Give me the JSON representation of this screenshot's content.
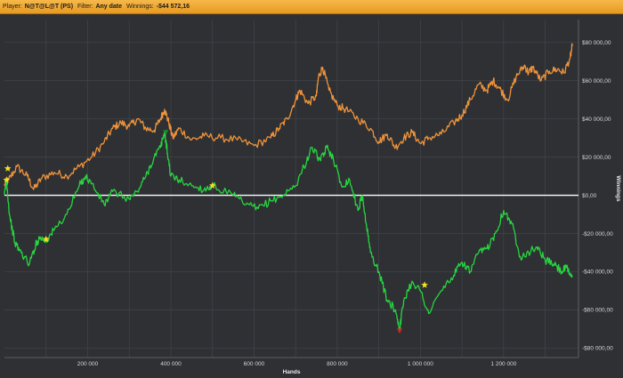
{
  "header": {
    "player_label": "Player:",
    "player_value": "N@T@L@T (PS)",
    "filter_label": "Filter:",
    "filter_value": "Any date",
    "winnings_label": "Winnings:",
    "winnings_value": "-$44 572,16"
  },
  "colors": {
    "background": "#2e3034",
    "grid": "#3f4247",
    "orange_series": "#f0933a",
    "green_series": "#27d63f",
    "zero_line": "#ffffff",
    "star": "#f5e020",
    "red_marker": "#e02020",
    "green_marker": "#1b8a2a"
  },
  "chart_data": {
    "type": "line",
    "title": "",
    "xlabel": "Hands",
    "ylabel": "Winnings",
    "xlim": [
      0,
      1380000
    ],
    "ylim": [
      -85000,
      92000
    ],
    "x_ticks": [
      200000,
      400000,
      600000,
      800000,
      1000000,
      1200000
    ],
    "x_tick_labels": [
      "200 000",
      "400 000",
      "600 000",
      "800 000",
      "1 000 000",
      "1 200 000"
    ],
    "y_ticks": [
      80000,
      60000,
      40000,
      20000,
      0,
      -20000,
      -40000,
      -60000,
      -80000
    ],
    "y_tick_labels": [
      "$80 000,00",
      "$60 000,00",
      "$40 000,00",
      "$20 000,00",
      "$0,00",
      "-$20 000,00",
      "-$40 000,00",
      "-$60 000,00",
      "-$80 000,00"
    ],
    "grid": true,
    "legend": "none",
    "series": [
      {
        "color": "orange",
        "x": [
          0,
          10000,
          30000,
          55000,
          70000,
          90000,
          120000,
          150000,
          180000,
          210000,
          240000,
          260000,
          280000,
          300000,
          320000,
          340000,
          360000,
          375000,
          385000,
          395000,
          405000,
          420000,
          450000,
          480000,
          520000,
          560000,
          600000,
          640000,
          660000,
          680000,
          700000,
          710000,
          730000,
          750000,
          755000,
          765000,
          780000,
          800000,
          820000,
          850000,
          880000,
          900000,
          920000,
          940000,
          960000,
          980000,
          1000000,
          1020000,
          1050000,
          1080000,
          1100000,
          1120000,
          1140000,
          1160000,
          1175000,
          1190000,
          1210000,
          1230000,
          1250000,
          1260000,
          1270000,
          1290000,
          1310000,
          1330000,
          1345000,
          1360000,
          1365000
        ],
        "y": [
          5000,
          8000,
          15000,
          10000,
          3000,
          9000,
          12000,
          10000,
          15000,
          20000,
          28000,
          35000,
          38000,
          36000,
          40000,
          35000,
          34000,
          40000,
          45000,
          38000,
          30000,
          35000,
          29000,
          31000,
          30000,
          29000,
          26000,
          30000,
          35000,
          40000,
          50000,
          55000,
          48000,
          52000,
          62000,
          67000,
          55000,
          47000,
          45000,
          40000,
          35000,
          28000,
          32000,
          25000,
          30000,
          33000,
          27000,
          30000,
          32000,
          38000,
          42000,
          50000,
          58000,
          55000,
          60000,
          56000,
          50000,
          62000,
          68000,
          64000,
          67000,
          60000,
          65000,
          66000,
          64000,
          72000,
          78000
        ]
      },
      {
        "color": "green",
        "x": [
          0,
          5000,
          12000,
          25000,
          40000,
          60000,
          75000,
          85000,
          100000,
          120000,
          150000,
          180000,
          195000,
          210000,
          240000,
          260000,
          300000,
          320000,
          340000,
          360000,
          375000,
          385000,
          392000,
          400000,
          420000,
          450000,
          480000,
          500000,
          550000,
          580000,
          610000,
          640000,
          670000,
          700000,
          720000,
          740000,
          760000,
          775000,
          790000,
          810000,
          830000,
          850000,
          860000,
          870000,
          880000,
          900000,
          920000,
          940000,
          950000,
          960000,
          980000,
          1000000,
          1020000,
          1050000,
          1080000,
          1100000,
          1120000,
          1140000,
          1160000,
          1180000,
          1200000,
          1220000,
          1240000,
          1260000,
          1280000,
          1300000,
          1320000,
          1340000,
          1350000,
          1365000
        ],
        "y": [
          0,
          8000,
          -10000,
          -25000,
          -30000,
          -36000,
          -26000,
          -22000,
          -24000,
          -18000,
          -10000,
          5000,
          10000,
          6000,
          -5000,
          2000,
          -2000,
          2000,
          10000,
          20000,
          25000,
          33000,
          22000,
          10000,
          8000,
          5000,
          3000,
          5000,
          0,
          -5000,
          -7000,
          -3000,
          0,
          5000,
          15000,
          25000,
          18000,
          25000,
          20000,
          5000,
          8000,
          -8000,
          0,
          -15000,
          -30000,
          -40000,
          -55000,
          -60000,
          -70000,
          -55000,
          -45000,
          -50000,
          -62000,
          -50000,
          -42000,
          -35000,
          -40000,
          -30000,
          -28000,
          -20000,
          -8000,
          -15000,
          -32000,
          -30000,
          -27000,
          -34000,
          -36000,
          -40000,
          -38000,
          -43000
        ]
      }
    ],
    "markers": [
      {
        "shape": "star",
        "x": 8000,
        "y": 14000
      },
      {
        "shape": "star",
        "x": 5000,
        "y": 8000
      },
      {
        "shape": "star",
        "x": 100000,
        "y": -23000
      },
      {
        "shape": "star",
        "x": 500000,
        "y": 5000
      },
      {
        "shape": "star",
        "x": 1010000,
        "y": -47000
      },
      {
        "shape": "triangle-down",
        "color": "red",
        "x": 950000,
        "y": -71000
      },
      {
        "shape": "triangle-down",
        "color": "green",
        "x": 388000,
        "y": 33000
      }
    ]
  }
}
